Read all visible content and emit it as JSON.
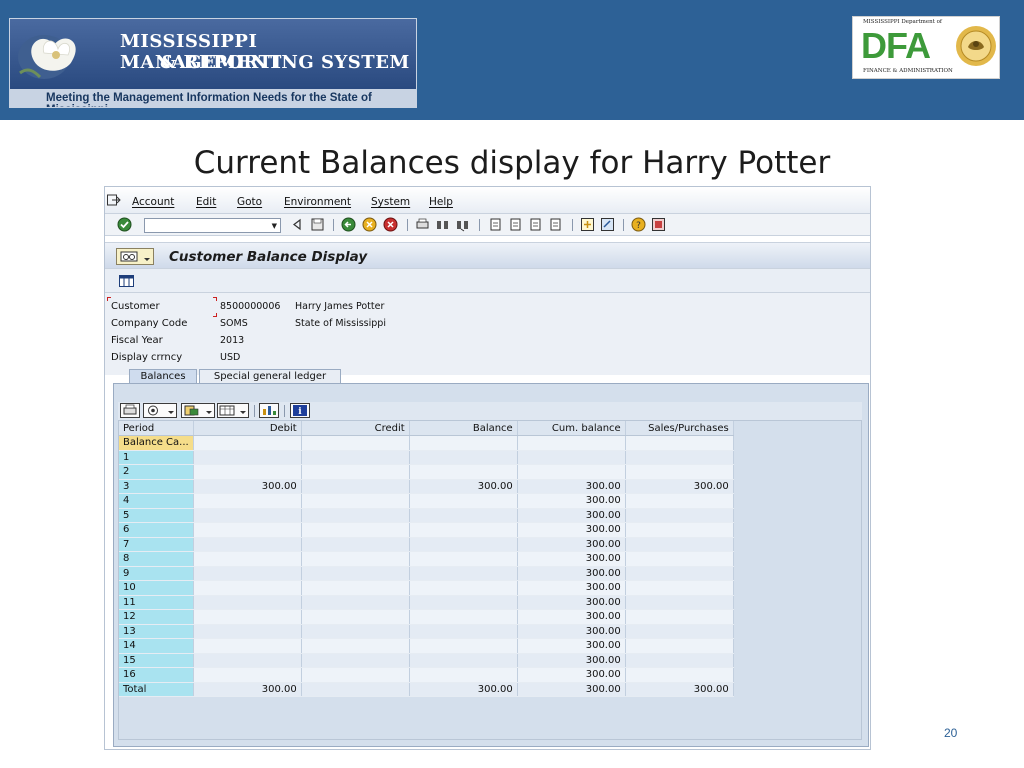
{
  "banner": {
    "line1": "MISSISSIPPI MANAGEMENT",
    "line2": "& REPORTING SYSTEM",
    "tagline": "Meeting the Management Information Needs for the State of Mississippi"
  },
  "dfa_logo": {
    "top_text": "MISSISSIPPI Department of",
    "letters": "DFA",
    "bottom_text": "FINANCE & ADMINISTRATION"
  },
  "slide": {
    "title": "Current Balances display for Harry Potter",
    "page_number": "20"
  },
  "sap": {
    "menu": [
      "Account",
      "Edit",
      "Goto",
      "Environment",
      "System",
      "Help"
    ],
    "screen_title": "Customer Balance Display",
    "fields": [
      {
        "label": "Customer",
        "value": "8500000006",
        "desc": "Harry James Potter"
      },
      {
        "label": "Company Code",
        "value": "SOMS",
        "desc": "State of Mississippi"
      },
      {
        "label": "Fiscal Year",
        "value": "2013",
        "desc": ""
      },
      {
        "label": "Display crrncy",
        "value": "USD",
        "desc": ""
      }
    ],
    "tabs": [
      "Balances",
      "Special general ledger"
    ],
    "columns": [
      "Period",
      "Debit",
      "Credit",
      "Balance",
      "Cum. balance",
      "Sales/Purchases"
    ],
    "rows": [
      [
        "Balance Ca...",
        "",
        "",
        "",
        "",
        ""
      ],
      [
        "1",
        "",
        "",
        "",
        "",
        ""
      ],
      [
        "2",
        "",
        "",
        "",
        "",
        ""
      ],
      [
        "3",
        "300.00",
        "",
        "300.00",
        "300.00",
        "300.00"
      ],
      [
        "4",
        "",
        "",
        "",
        "300.00",
        ""
      ],
      [
        "5",
        "",
        "",
        "",
        "300.00",
        ""
      ],
      [
        "6",
        "",
        "",
        "",
        "300.00",
        ""
      ],
      [
        "7",
        "",
        "",
        "",
        "300.00",
        ""
      ],
      [
        "8",
        "",
        "",
        "",
        "300.00",
        ""
      ],
      [
        "9",
        "",
        "",
        "",
        "300.00",
        ""
      ],
      [
        "10",
        "",
        "",
        "",
        "300.00",
        ""
      ],
      [
        "11",
        "",
        "",
        "",
        "300.00",
        ""
      ],
      [
        "12",
        "",
        "",
        "",
        "300.00",
        ""
      ],
      [
        "13",
        "",
        "",
        "",
        "300.00",
        ""
      ],
      [
        "14",
        "",
        "",
        "",
        "300.00",
        ""
      ],
      [
        "15",
        "",
        "",
        "",
        "300.00",
        ""
      ],
      [
        "16",
        "",
        "",
        "",
        "300.00",
        ""
      ],
      [
        "Total",
        "300.00",
        "",
        "300.00",
        "300.00",
        "300.00"
      ]
    ]
  },
  "colors": {
    "header_band": "#2d6196",
    "dfa_green": "#3d9a3a",
    "key_column": "#a9e3f0",
    "selected_key": "#f5dd8a"
  }
}
